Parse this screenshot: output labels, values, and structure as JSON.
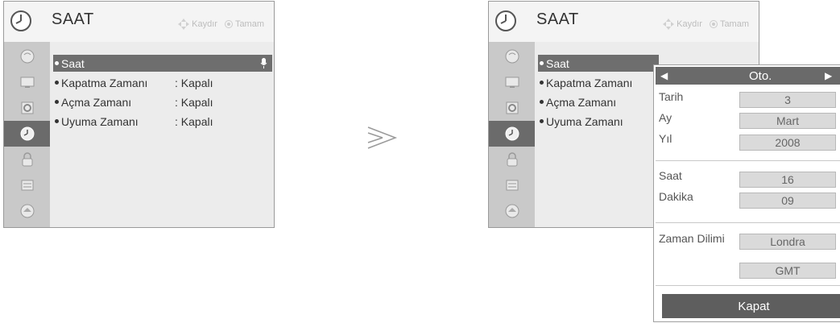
{
  "left": {
    "title": "SAAT",
    "hint_move": "Kaydır",
    "hint_ok": "Tamam",
    "sidebar_icons": [
      "picture-icon",
      "screen-icon",
      "audio-icon",
      "clock-icon",
      "lock-icon",
      "option-icon",
      "setup-icon"
    ],
    "active_sidebar": "clock-icon",
    "items": [
      {
        "label": "Saat",
        "value": ""
      },
      {
        "label": "Kapatma Zamanı",
        "value": ": Kapalı"
      },
      {
        "label": "Açma Zamanı",
        "value": ": Kapalı"
      },
      {
        "label": "Uyuma Zamanı",
        "value": ": Kapalı"
      }
    ],
    "selected_item": "Saat"
  },
  "right": {
    "title": "SAAT",
    "hint_move": "Kaydır",
    "hint_ok": "Tamam",
    "items": [
      {
        "label": "Saat"
      },
      {
        "label": "Kapatma Zamanı"
      },
      {
        "label": "Açma Zamanı"
      },
      {
        "label": "Uyuma Zamanı"
      }
    ]
  },
  "popup": {
    "mode": "Oto.",
    "fields": [
      {
        "label": "Tarih",
        "value": "3"
      },
      {
        "label": "Ay",
        "value": "Mart"
      },
      {
        "label": "Yıl",
        "value": "2008"
      },
      {
        "label": "Saat",
        "value": "16"
      },
      {
        "label": "Dakika",
        "value": "09"
      },
      {
        "label": "Zaman Dilimi",
        "value": "Londra"
      },
      {
        "label": "",
        "value": "GMT"
      }
    ],
    "close_label": "Kapat"
  },
  "colors": {
    "selected_row": "#6e6e6e",
    "sidebar": "#c9c9c9",
    "active_sidebar": "#6b6b6b"
  }
}
